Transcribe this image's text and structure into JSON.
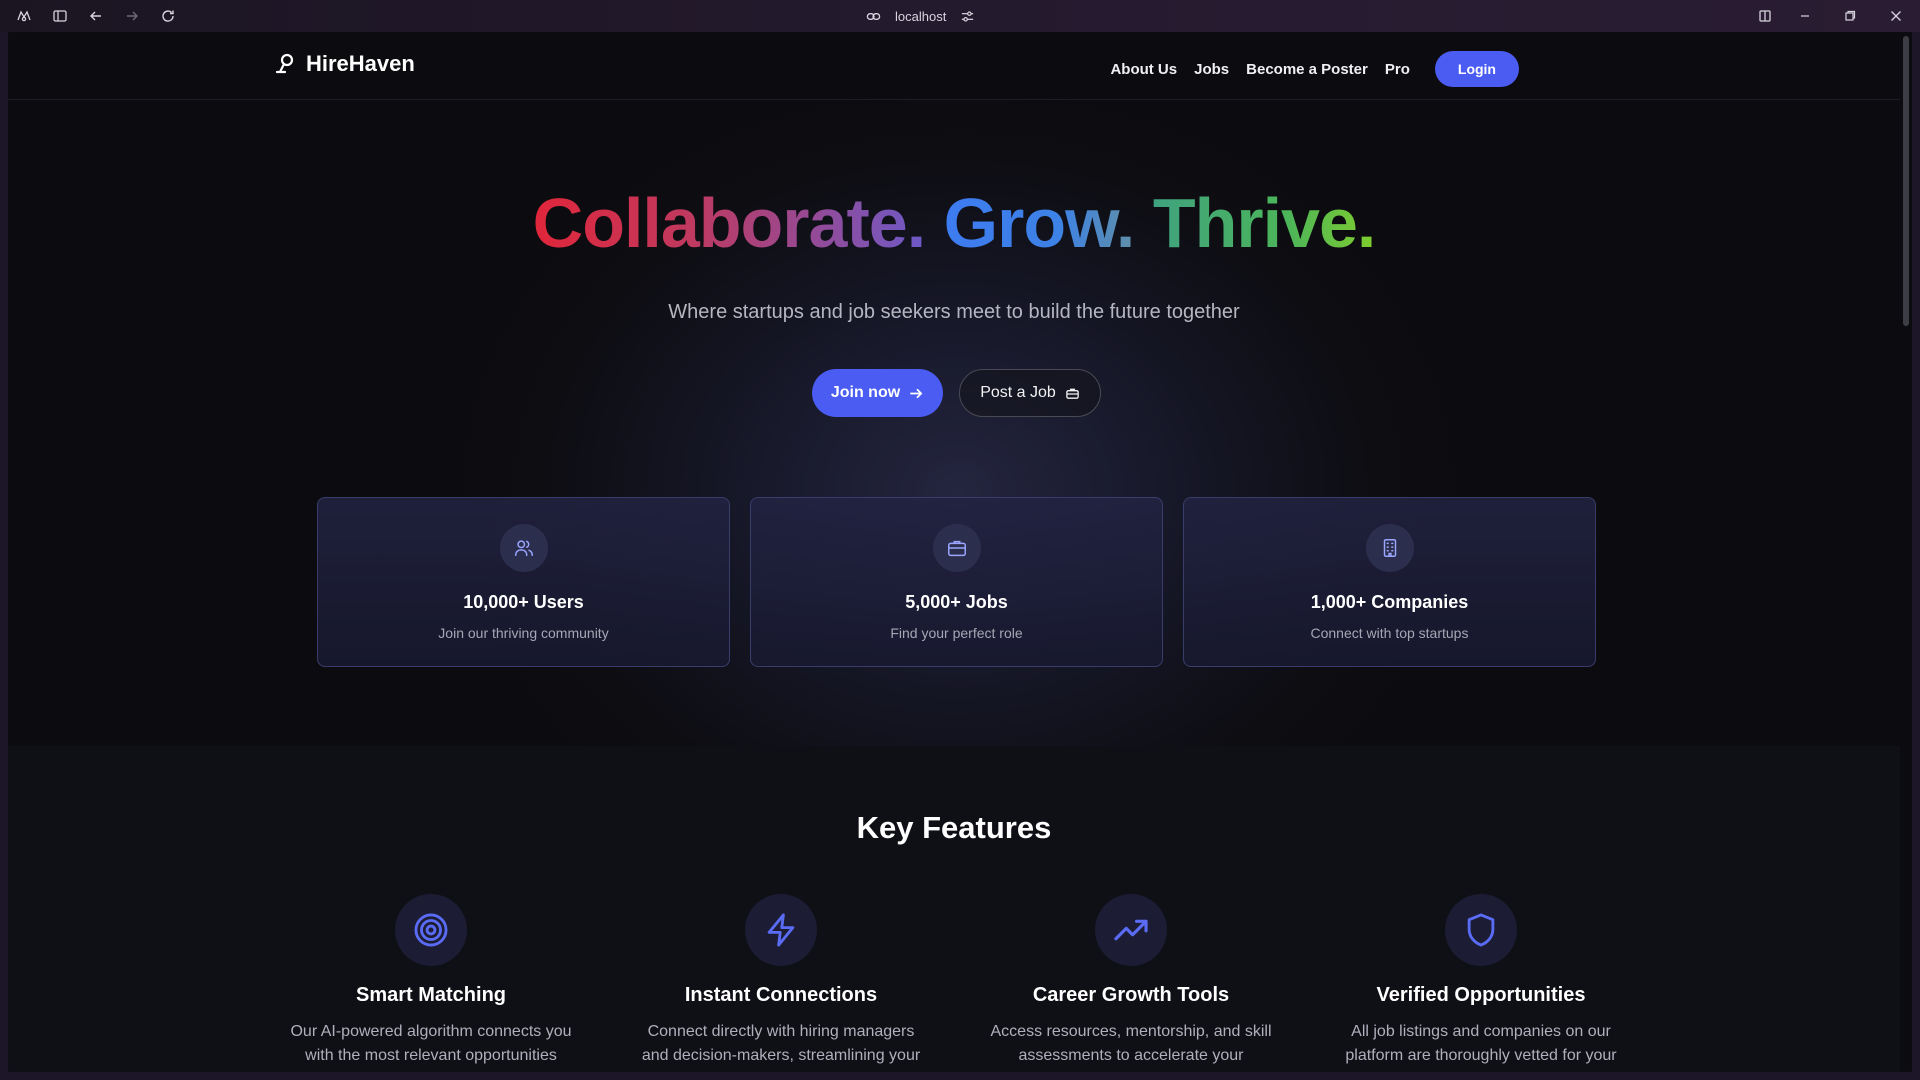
{
  "browser": {
    "address": "localhost"
  },
  "nav": {
    "brand": "HireHaven",
    "links": [
      "About Us",
      "Jobs",
      "Become a Poster",
      "Pro"
    ],
    "login": "Login"
  },
  "hero": {
    "title_parts": [
      "Collaborate.",
      "Grow.",
      "Thrive."
    ],
    "subtitle": "Where startups and job seekers meet to build the future together",
    "join_label": "Join now",
    "post_label": "Post a Job",
    "stats": [
      {
        "title": "10,000+ Users",
        "desc": "Join our thriving community",
        "icon": "users-icon"
      },
      {
        "title": "5,000+ Jobs",
        "desc": "Find your perfect role",
        "icon": "briefcase-icon"
      },
      {
        "title": "1,000+ Companies",
        "desc": "Connect with top startups",
        "icon": "building-icon"
      }
    ]
  },
  "features": {
    "title": "Key Features",
    "items": [
      {
        "title": "Smart Matching",
        "desc": "Our AI-powered algorithm connects you with the most relevant opportunities tailored to your skills and preferences.",
        "icon": "target-icon"
      },
      {
        "title": "Instant Connections",
        "desc": "Connect directly with hiring managers and decision-makers, streamlining your job search process.",
        "icon": "lightning-icon"
      },
      {
        "title": "Career Growth Tools",
        "desc": "Access resources, mentorship, and skill assessments to accelerate your professional development.",
        "icon": "trending-up-icon"
      },
      {
        "title": "Verified Opportunities",
        "desc": "All job listings and companies on our platform are thoroughly vetted for your peace of mind.",
        "icon": "shield-icon"
      }
    ]
  },
  "colors": {
    "accent": "#4a5cf2",
    "background": "#0c0c10"
  }
}
